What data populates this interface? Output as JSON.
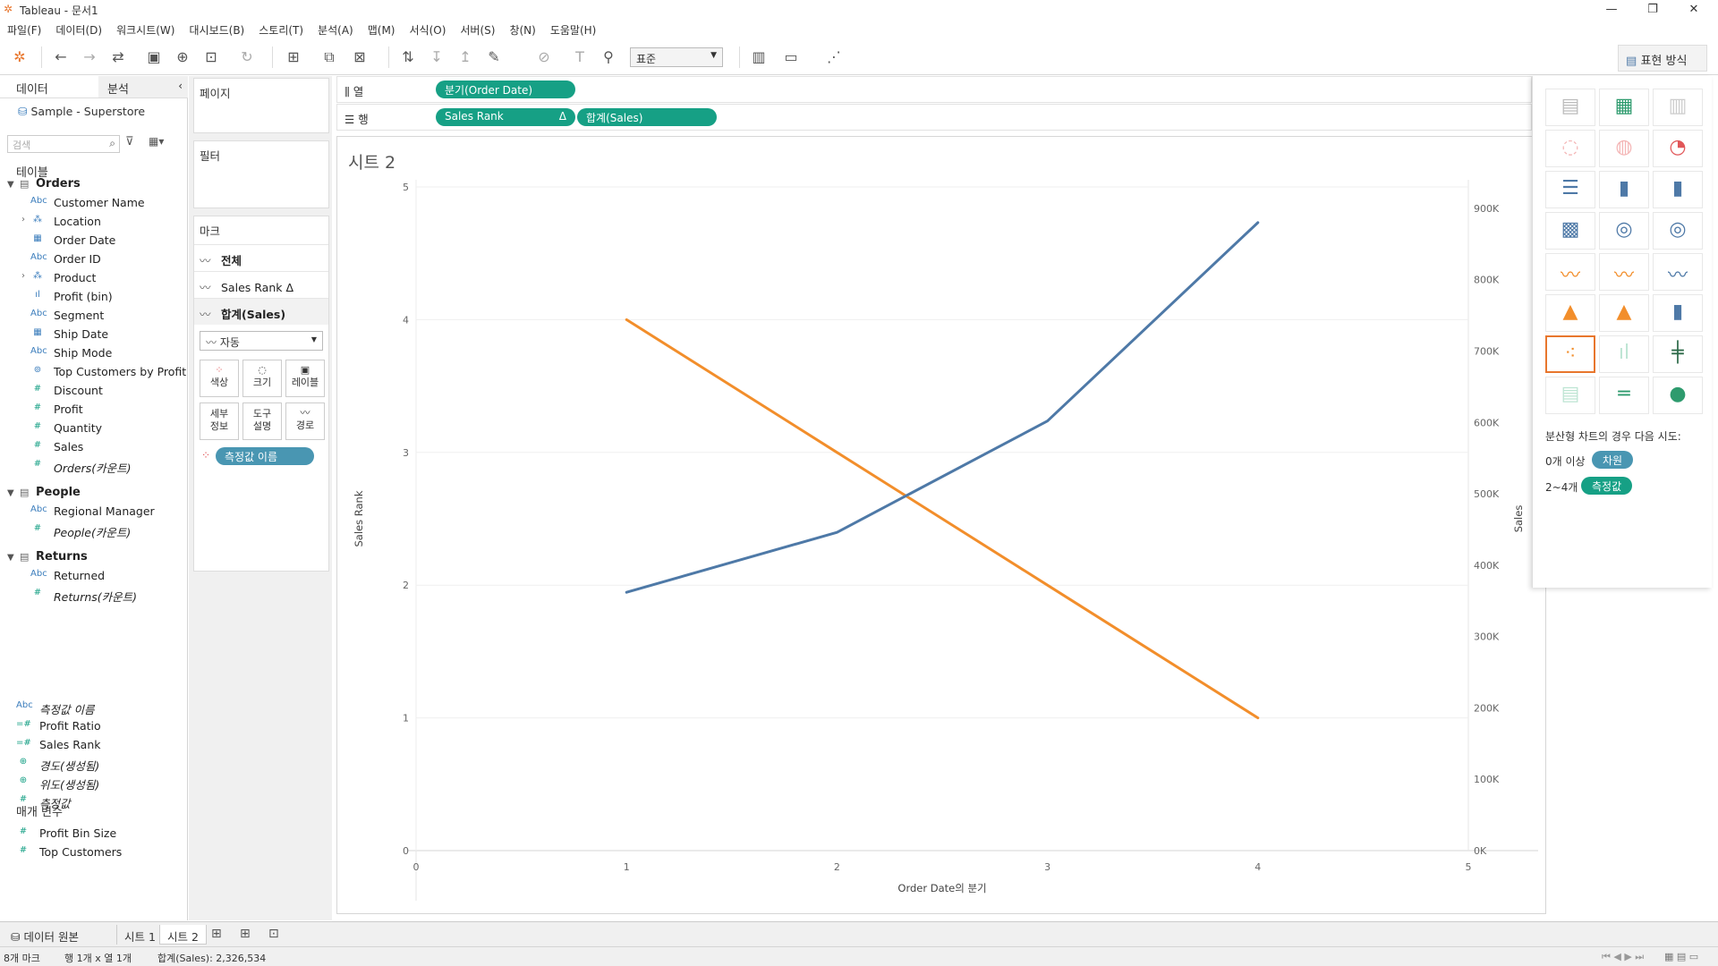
{
  "window": {
    "title": "Tableau - 문서1"
  },
  "menu": [
    "파일(F)",
    "데이터(D)",
    "워크시트(W)",
    "대시보드(B)",
    "스토리(T)",
    "분석(A)",
    "맵(M)",
    "서식(O)",
    "서버(S)",
    "창(N)",
    "도움말(H)"
  ],
  "toolbar": {
    "fit_select": "표준",
    "show_me_label": "표현 방식"
  },
  "left_pane": {
    "tab_data": "데이터",
    "tab_analysis": "분석",
    "datasource": "Sample - Superstore",
    "search_placeholder": "검색",
    "tables_heading": "테이블",
    "groups": [
      {
        "name": "Orders",
        "fields": [
          {
            "icon": "Abc",
            "label": "Customer Name"
          },
          {
            "icon": "geo",
            "label": "Location"
          },
          {
            "icon": "date",
            "label": "Order Date"
          },
          {
            "icon": "Abc",
            "label": "Order ID"
          },
          {
            "icon": "hier",
            "label": "Product"
          },
          {
            "icon": "bin",
            "label": "Profit (bin)"
          },
          {
            "icon": "Abc",
            "label": "Segment"
          },
          {
            "icon": "date",
            "label": "Ship Date"
          },
          {
            "icon": "Abc",
            "label": "Ship Mode"
          },
          {
            "icon": "set",
            "label": "Top Customers by Profit"
          },
          {
            "icon": "#",
            "label": "Discount"
          },
          {
            "icon": "#",
            "label": "Profit"
          },
          {
            "icon": "#",
            "label": "Quantity"
          },
          {
            "icon": "#",
            "label": "Sales"
          },
          {
            "icon": "#",
            "label": "Orders(카운트)"
          }
        ]
      },
      {
        "name": "People",
        "fields": [
          {
            "icon": "Abc",
            "label": "Regional Manager"
          },
          {
            "icon": "#",
            "label": "People(카운트)"
          }
        ]
      },
      {
        "name": "Returns",
        "fields": [
          {
            "icon": "Abc",
            "label": "Returned"
          },
          {
            "icon": "#",
            "label": "Returns(카운트)"
          }
        ]
      }
    ],
    "loose_fields": [
      {
        "icon": "Abc",
        "label": "측정값 이름"
      },
      {
        "icon": "=#",
        "label": "Profit Ratio"
      },
      {
        "icon": "=#",
        "label": "Sales Rank"
      },
      {
        "icon": "globe",
        "label": "경도(생성됨)"
      },
      {
        "icon": "globe",
        "label": "위도(생성됨)"
      },
      {
        "icon": "#",
        "label": "측정값"
      }
    ],
    "params_heading": "매개 변수",
    "params": [
      "Profit Bin Size",
      "Top Customers"
    ]
  },
  "cards": {
    "pages": "페이지",
    "filters": "필터",
    "marks": "마크",
    "mark_rows": [
      "전체",
      "Sales Rank Δ",
      "합계(Sales)"
    ],
    "mark_type": "자동",
    "buttons": [
      "색상",
      "크기",
      "레이블",
      "세부\n정보",
      "도구\n설명",
      "경로"
    ],
    "color_pill": "측정값 이름"
  },
  "shelves": {
    "columns_label": "열",
    "rows_label": "행",
    "columns_pill": "분기(Order Date)",
    "rows_pills": [
      "Sales Rank",
      "합계(Sales)"
    ],
    "rows_delta": "Δ"
  },
  "sheet": {
    "title": "시트 2"
  },
  "chart_data": {
    "type": "line",
    "xlabel": "Order Date의 분기",
    "ylabel_left": "Sales Rank",
    "ylabel_right": "Sales",
    "x_ticks": [
      "0",
      "1",
      "2",
      "3",
      "4",
      "5"
    ],
    "left_ticks": [
      "0",
      "1",
      "2",
      "3",
      "4",
      "5"
    ],
    "right_ticks": [
      "0K",
      "100K",
      "200K",
      "300K",
      "400K",
      "500K",
      "600K",
      "700K",
      "800K",
      "900K"
    ],
    "xlim": [
      0,
      5
    ],
    "ylim_left": [
      0,
      5
    ],
    "ylim_right": [
      0,
      930000
    ],
    "series": [
      {
        "name": "Sales Rank Δ",
        "axis": "left",
        "color": "#f28e2b",
        "x": [
          1,
          2,
          3,
          4
        ],
        "values": [
          4,
          3,
          2,
          1
        ]
      },
      {
        "name": "합계(Sales)",
        "axis": "right",
        "color": "#4e79a7",
        "x": [
          1,
          2,
          3,
          4
        ],
        "values": [
          362000,
          446000,
          602000,
          880000
        ]
      }
    ]
  },
  "show_me": {
    "hint_text": "분산형 차트의 경우 다음 시도:",
    "row1_prefix": "0개 이상",
    "row1_pill": "차원",
    "row2_prefix": "2~4개",
    "row2_pill": "측정값"
  },
  "sheet_tabs": {
    "datasource": "데이터 원본",
    "tabs": [
      "시트 1",
      "시트 2"
    ]
  },
  "status": {
    "marks": "8개 마크",
    "rows_cols": "행 1개 x 열 1개",
    "sum": "합계(Sales): 2,326,534"
  },
  "colors": {
    "dim_pill": "#4996b2",
    "measure_pill": "#16a085",
    "orange": "#f28e2b",
    "blue": "#4e79a7"
  }
}
